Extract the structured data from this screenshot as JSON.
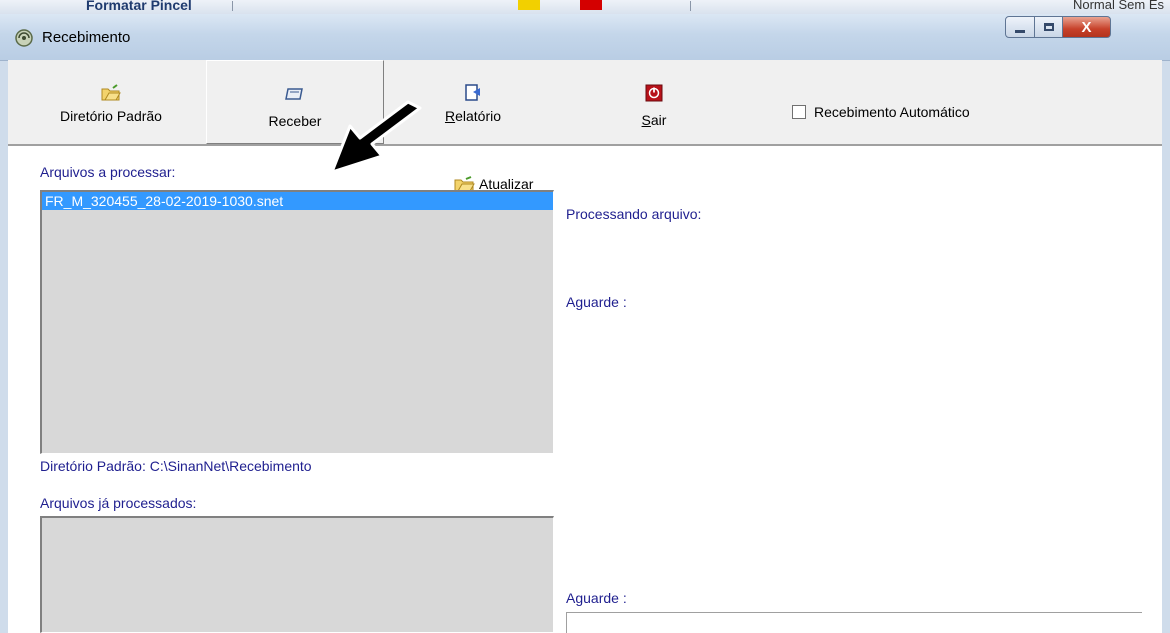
{
  "background_app": {
    "visible_text": "Formatar Pincel",
    "right_text": "Normal  Sem Es",
    "swatch_colors": [
      "#f2d000",
      "#d40000",
      "#f2d000"
    ]
  },
  "window": {
    "title": "Recebimento",
    "controls": {
      "minimize": "minimize",
      "maximize": "maximize",
      "close": "X"
    }
  },
  "toolbar": {
    "buttons": [
      {
        "label": "Diretório Padrão",
        "icon": "folder-icon"
      },
      {
        "label": "Receber",
        "icon": "receive-tray-icon"
      },
      {
        "label_accel": "R",
        "label_rest": "elatório",
        "icon": "report-icon"
      },
      {
        "label_accel": "S",
        "label_rest": "air",
        "icon": "power-exit-icon"
      }
    ],
    "auto_receive": {
      "label": "Recebimento Automático",
      "checked": false
    }
  },
  "left_panel": {
    "to_process_label": "Arquivos a processar:",
    "refresh_label": "Atualizar",
    "files_to_process": [
      "FR_M_320455_28-02-2019-1030.snet"
    ],
    "default_dir_label": "Diretório Padrão: C:\\SinanNet\\Recebimento",
    "processed_label": "Arquivos já processados:",
    "files_processed": []
  },
  "right_panel": {
    "processing_label": "Processando arquivo:",
    "wait_label_1": "Aguarde :",
    "wait_label_2": "Aguarde :"
  },
  "colors": {
    "selection": "#3399ff",
    "label_blue": "#1f1f8f",
    "list_bg": "#d8d8d8"
  }
}
